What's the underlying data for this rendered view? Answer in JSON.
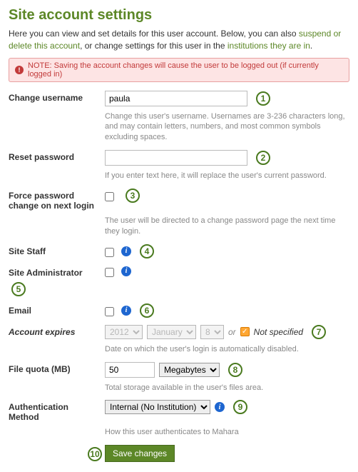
{
  "title": "Site account settings",
  "intro": {
    "text1": "Here you can view and set details for this user account. Below, you can also ",
    "link1": "suspend or delete this account",
    "text2": ", or change settings for this user in the ",
    "link2": "institutions they are in",
    "text3": "."
  },
  "note": "NOTE: Saving the account changes will cause the user to be logged out (if currently logged in)",
  "fields": {
    "change_username": {
      "label": "Change username",
      "value": "paula",
      "help": "Change this user's username. Usernames are 3-236 characters long, and may contain letters, numbers, and most common symbols excluding spaces."
    },
    "reset_password": {
      "label": "Reset password",
      "value": "",
      "help": "If you enter text here, it will replace the user's current password."
    },
    "force_pw": {
      "label": "Force password change on next login",
      "help": "The user will be directed to a change password page the next time they login."
    },
    "site_staff": {
      "label": "Site Staff"
    },
    "site_admin": {
      "label": "Site Administrator"
    },
    "email": {
      "label": "Email"
    },
    "expires": {
      "label": "Account expires",
      "year": "2012",
      "month": "January",
      "day": "8",
      "or": "or",
      "not_specified": "Not specified",
      "help": "Date on which the user's login is automatically disabled."
    },
    "quota": {
      "label": "File quota (MB)",
      "value": "50",
      "unit": "Megabytes",
      "help": "Total storage available in the user's files area."
    },
    "auth": {
      "label": "Authentication Method",
      "value": "Internal (No Institution)",
      "help": "How this user authenticates to Mahara"
    }
  },
  "badges": {
    "b1": "1",
    "b2": "2",
    "b3": "3",
    "b4": "4",
    "b5": "5",
    "b6": "6",
    "b7": "7",
    "b8": "8",
    "b9": "9",
    "b10": "10"
  },
  "save_label": "Save changes"
}
